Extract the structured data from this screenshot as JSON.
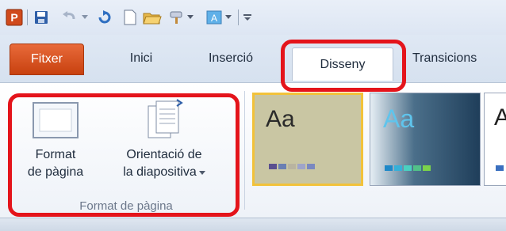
{
  "quick_access": {
    "icons": [
      "powerpoint-app-icon",
      "save-icon",
      "undo-icon",
      "redo-icon",
      "new-file-icon",
      "open-folder-icon",
      "format-painter-icon",
      "font-color-icon",
      "customize-quick-access-icon"
    ]
  },
  "tabs": [
    {
      "label": "Fitxer"
    },
    {
      "label": "Inici"
    },
    {
      "label": "Inserció"
    },
    {
      "label": "Disseny"
    },
    {
      "label": "Transicions"
    }
  ],
  "page_setup_group": {
    "format_button": {
      "line1": "Format",
      "line2": "de pàgina"
    },
    "orientation_button": {
      "line1": "Orientació de",
      "line2": "la diapositiva"
    },
    "group_label": "Format de pàgina"
  },
  "themes": [
    {
      "sample_text": "Aa",
      "bg": "#c9c6a3",
      "fg": "#2a2a2a",
      "selected": true,
      "swatch_colors": [
        "#5a4f8f",
        "#6a7fb3",
        "#b9b4a0",
        "#9fa4c9",
        "#7a88c0"
      ]
    },
    {
      "sample_text": "Aa",
      "bg": "#1f3e5a",
      "fg": "#5fc4ec",
      "selected": false,
      "swatch_colors": [
        "#1e88c8",
        "#36b0d8",
        "#4ad0c0",
        "#52c088",
        "#7bd24a"
      ]
    },
    {
      "sample_text": "A",
      "bg": "#ffffff",
      "fg": "#222222",
      "selected": false,
      "swatch_colors": [
        "#3a6fbf"
      ]
    }
  ],
  "colors": {
    "accent": "#e4141b",
    "file_tab": "#d5521f",
    "ribbon_bg": "#dfe8f4"
  }
}
